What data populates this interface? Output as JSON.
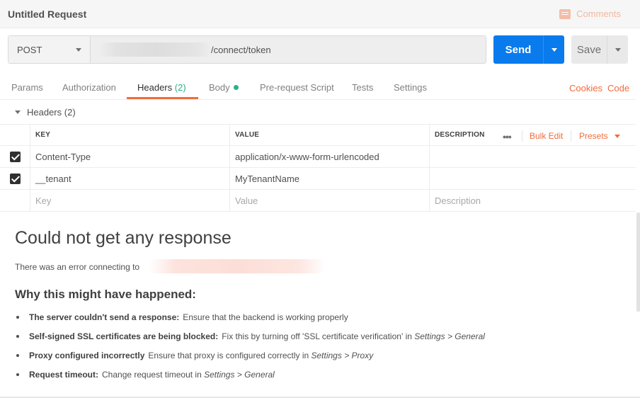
{
  "window": {
    "title": "Untitled Request",
    "comments_label": "Comments"
  },
  "request": {
    "method": "POST",
    "url_path": "/connect/token",
    "send_label": "Send",
    "save_label": "Save"
  },
  "tabs": [
    {
      "label": "Params"
    },
    {
      "label": "Authorization"
    },
    {
      "label": "Headers",
      "count": "(2)",
      "active": true
    },
    {
      "label": "Body"
    },
    {
      "label": "Pre-request Script"
    },
    {
      "label": "Tests"
    },
    {
      "label": "Settings"
    }
  ],
  "tab_links": {
    "cookies": "Cookies",
    "code": "Code"
  },
  "headers_section": {
    "title": "Headers",
    "count": "(2)",
    "columns": {
      "key": "KEY",
      "value": "VALUE",
      "description": "DESCRIPTION"
    },
    "more_label": "•••",
    "bulk_edit": "Bulk Edit",
    "presets": "Presets",
    "rows": [
      {
        "checked": true,
        "key": "Content-Type",
        "value": "application/x-www-form-urlencoded",
        "description": ""
      },
      {
        "checked": true,
        "key": "__tenant",
        "value": "MyTenantName",
        "description": ""
      }
    ],
    "placeholder": {
      "key": "Key",
      "value": "Value",
      "description": "Description"
    }
  },
  "response": {
    "title": "Could not get any response",
    "message": "There was an error connecting to",
    "why_title": "Why this might have happened:",
    "reasons": [
      {
        "bold": "The server couldn't send a response:",
        "text": "Ensure that the backend is working properly",
        "italic": ""
      },
      {
        "bold": "Self-signed SSL certificates are being blocked:",
        "text": "Fix this by turning off 'SSL certificate verification' in ",
        "italic": "Settings > General"
      },
      {
        "bold": "Proxy configured incorrectly",
        "text": "Ensure that proxy is configured correctly in ",
        "italic": "Settings > Proxy"
      },
      {
        "bold": "Request timeout:",
        "text": "Change request timeout in ",
        "italic": "Settings > General"
      }
    ]
  },
  "colors": {
    "accent": "#f26b3a",
    "send": "#097bed",
    "success": "#26b47f"
  }
}
